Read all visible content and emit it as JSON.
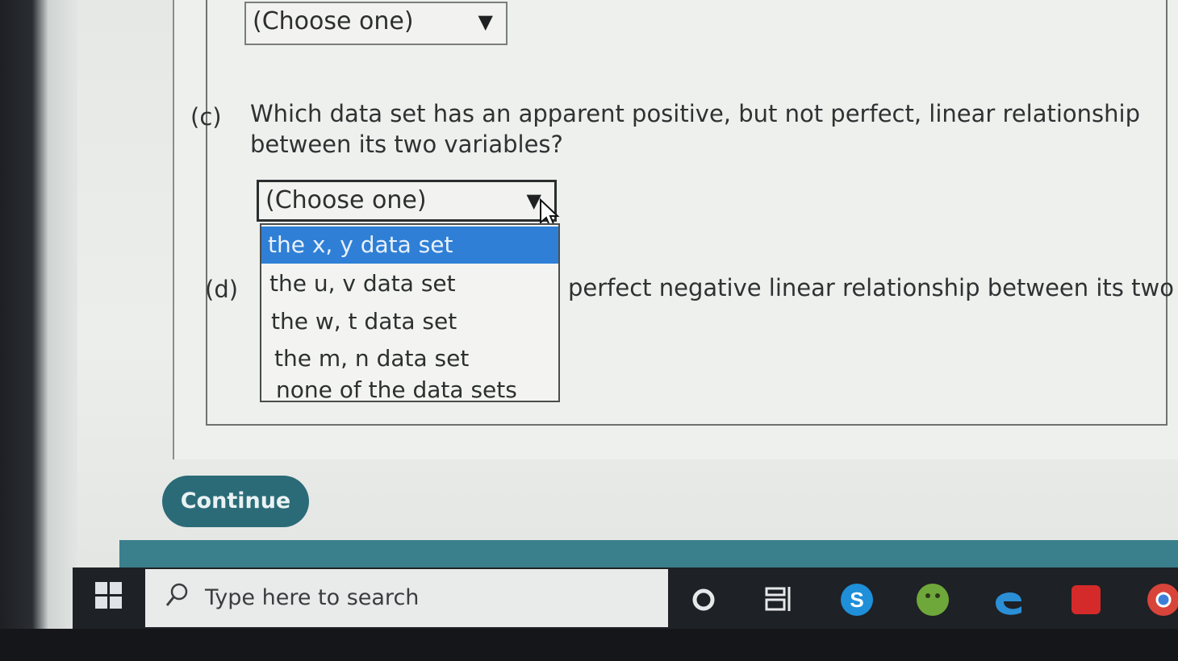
{
  "top_select": {
    "value": "(Choose one)",
    "arrow": "▼"
  },
  "part_c": {
    "label": "(c)",
    "question": "Which data set has an apparent positive, but not perfect, linear relationship between its two variables?",
    "select": {
      "value": "(Choose one)",
      "arrow": "▼"
    },
    "options": [
      "the x, y data set",
      "the u, v data set",
      "the w, t data set",
      "the m, n data set",
      "none of the data sets"
    ],
    "selected_index": 0
  },
  "part_d": {
    "label": "(d)",
    "question_visible": "perfect negative linear relationship between its two"
  },
  "continue_button": {
    "label": "Continue"
  },
  "taskbar": {
    "search_placeholder": "Type here to search",
    "icons": [
      "windows-start-icon",
      "search-icon",
      "cortana-icon",
      "task-view-icon",
      "skype-icon",
      "android-app-icon",
      "edge-icon",
      "red-app-icon",
      "chrome-icon"
    ]
  },
  "colors": {
    "accent_selected": "#2f7fd6",
    "continue_button": "#2b6b78",
    "taskbar": "#1e2126"
  }
}
